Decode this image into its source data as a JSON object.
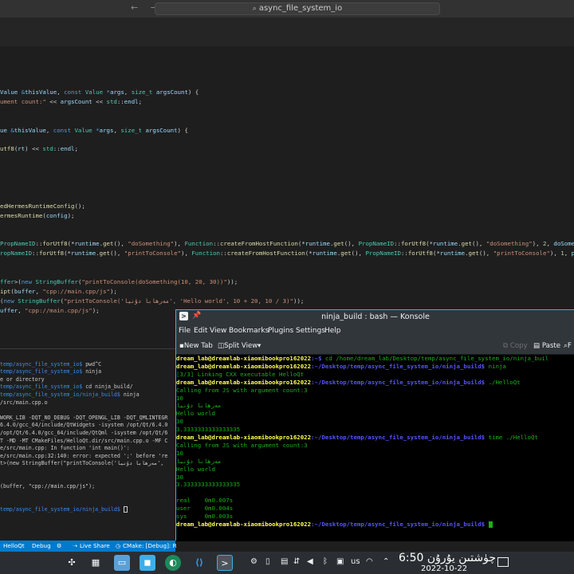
{
  "vscode": {
    "titlebar": {
      "nav_arrows": "← →",
      "search_text": "async_file_system_io"
    },
    "editor_lines": [
      {
        "segments": [
          [
            "var",
            "Value"
          ],
          [
            "plain",
            " "
          ],
          [
            "kw",
            "&"
          ],
          [
            "var",
            "thisValue"
          ],
          [
            "plain",
            ", "
          ],
          [
            "kw",
            "const"
          ],
          [
            "plain",
            " "
          ],
          [
            "ty",
            "Value"
          ],
          [
            "plain",
            " "
          ],
          [
            "kw",
            "*"
          ],
          [
            "var",
            "args"
          ],
          [
            "plain",
            ", "
          ],
          [
            "ty",
            "size_t"
          ],
          [
            "plain",
            " "
          ],
          [
            "var",
            "argsCount"
          ],
          [
            "plain",
            ") {"
          ]
        ]
      },
      {
        "segments": [
          [
            "str",
            "ument count:\""
          ],
          [
            "plain",
            " << "
          ],
          [
            "var",
            "argsCount"
          ],
          [
            "plain",
            " << "
          ],
          [
            "ty",
            "std"
          ],
          [
            "plain",
            "::"
          ],
          [
            "var",
            "endl"
          ],
          [
            "plain",
            ";"
          ]
        ]
      },
      {
        "segments": []
      },
      {
        "segments": []
      },
      {
        "segments": [
          [
            "var",
            "ue"
          ],
          [
            "plain",
            " "
          ],
          [
            "kw",
            "&"
          ],
          [
            "var",
            "thisValue"
          ],
          [
            "plain",
            ", "
          ],
          [
            "kw",
            "const"
          ],
          [
            "plain",
            " "
          ],
          [
            "ty",
            "Value"
          ],
          [
            "plain",
            " "
          ],
          [
            "kw",
            "*"
          ],
          [
            "var",
            "args"
          ],
          [
            "plain",
            ", "
          ],
          [
            "ty",
            "size_t"
          ],
          [
            "plain",
            " "
          ],
          [
            "var",
            "argsCount"
          ],
          [
            "plain",
            ") {"
          ]
        ]
      },
      {
        "segments": []
      },
      {
        "segments": [
          [
            "fn",
            "utf8"
          ],
          [
            "plain",
            "("
          ],
          [
            "var",
            "rt"
          ],
          [
            "plain",
            ") << "
          ],
          [
            "ty",
            "std"
          ],
          [
            "plain",
            "::"
          ],
          [
            "var",
            "endl"
          ],
          [
            "plain",
            ";"
          ]
        ]
      },
      {
        "segments": []
      },
      {
        "segments": []
      },
      {
        "segments": []
      },
      {
        "segments": []
      },
      {
        "segments": []
      },
      {
        "segments": [
          [
            "fn",
            "edHermesRuntimeConfig"
          ],
          [
            "plain",
            "();"
          ]
        ]
      },
      {
        "segments": [
          [
            "fn",
            "ermesRuntime"
          ],
          [
            "plain",
            "("
          ],
          [
            "var",
            "config"
          ],
          [
            "plain",
            ");"
          ]
        ]
      },
      {
        "segments": []
      },
      {
        "segments": []
      },
      {
        "segments": [
          [
            "ty",
            "PropNameID"
          ],
          [
            "plain",
            "::"
          ],
          [
            "fn",
            "forUtf8"
          ],
          [
            "plain",
            "(*"
          ],
          [
            "var",
            "runtime"
          ],
          [
            "plain",
            "."
          ],
          [
            "fn",
            "get"
          ],
          [
            "plain",
            "(), "
          ],
          [
            "str",
            "\"doSomething\""
          ],
          [
            "plain",
            "), "
          ],
          [
            "ty",
            "Function"
          ],
          [
            "plain",
            "::"
          ],
          [
            "fn",
            "createFromHostFunction"
          ],
          [
            "plain",
            "(*"
          ],
          [
            "var",
            "runtime"
          ],
          [
            "plain",
            "."
          ],
          [
            "fn",
            "get"
          ],
          [
            "plain",
            "(), "
          ],
          [
            "ty",
            "PropNameID"
          ],
          [
            "plain",
            "::"
          ],
          [
            "fn",
            "forUtf8"
          ],
          [
            "plain",
            "(*"
          ],
          [
            "var",
            "runtime"
          ],
          [
            "plain",
            "."
          ],
          [
            "fn",
            "get"
          ],
          [
            "plain",
            "(), "
          ],
          [
            "str",
            "\"doSomething\""
          ],
          [
            "plain",
            "), "
          ],
          [
            "num",
            "2"
          ],
          [
            "plain",
            ", "
          ],
          [
            "var",
            "doSomethingFromJs"
          ],
          [
            "plain",
            ")"
          ]
        ]
      },
      {
        "segments": [
          [
            "ty",
            "ropNameID"
          ],
          [
            "plain",
            "::"
          ],
          [
            "fn",
            "forUtf8"
          ],
          [
            "plain",
            "(*"
          ],
          [
            "var",
            "runtime"
          ],
          [
            "plain",
            "."
          ],
          [
            "fn",
            "get"
          ],
          [
            "plain",
            "(), "
          ],
          [
            "str",
            "\"printToConsole\""
          ],
          [
            "plain",
            "), "
          ],
          [
            "ty",
            "Function"
          ],
          [
            "plain",
            "::"
          ],
          [
            "fn",
            "createFromHostFunction"
          ],
          [
            "plain",
            "(*"
          ],
          [
            "var",
            "runtime"
          ],
          [
            "plain",
            "."
          ],
          [
            "fn",
            "get"
          ],
          [
            "plain",
            "(), "
          ],
          [
            "ty",
            "PropNameID"
          ],
          [
            "plain",
            "::"
          ],
          [
            "fn",
            "forUtf8"
          ],
          [
            "plain",
            "(*"
          ],
          [
            "var",
            "runtime"
          ],
          [
            "plain",
            "."
          ],
          [
            "fn",
            "get"
          ],
          [
            "plain",
            "(), "
          ],
          [
            "str",
            "\"printToConsole\""
          ],
          [
            "plain",
            "), "
          ],
          [
            "num",
            "1"
          ],
          [
            "plain",
            ", "
          ],
          [
            "var",
            "printToConsole"
          ]
        ]
      },
      {
        "segments": []
      },
      {
        "segments": []
      },
      {
        "segments": [
          [
            "ty",
            "ffer"
          ],
          [
            "plain",
            ">("
          ],
          [
            "kw",
            "new"
          ],
          [
            "plain",
            " "
          ],
          [
            "ty",
            "StringBuffer"
          ],
          [
            "plain",
            "("
          ],
          [
            "str",
            "\"printToConsole(doSomething(10, 20, 30))\""
          ],
          [
            "plain",
            "));"
          ]
        ]
      },
      {
        "segments": [
          [
            "fn",
            "ipt"
          ],
          [
            "plain",
            "("
          ],
          [
            "var",
            "buffer"
          ],
          [
            "plain",
            ", "
          ],
          [
            "str",
            "\"cpp://main.cpp/js\""
          ],
          [
            "plain",
            ");"
          ]
        ]
      },
      {
        "segments": [
          [
            "plain",
            "("
          ],
          [
            "kw",
            "new"
          ],
          [
            "plain",
            " "
          ],
          [
            "ty",
            "StringBuffer"
          ],
          [
            "plain",
            "("
          ],
          [
            "str",
            "\"printToConsole('مەرھابا دۇنيا', 'Hello world', 10 + 20, 10 / 3)\""
          ],
          [
            "plain",
            "));"
          ]
        ]
      },
      {
        "segments": [
          [
            "var",
            "uffer"
          ],
          [
            "plain",
            ", "
          ],
          [
            "str",
            "\"cpp://main.cpp/js\""
          ],
          [
            "plain",
            ");"
          ]
        ]
      }
    ],
    "terminal_lines": [
      {
        "prompt": "",
        "text": ""
      },
      {
        "prompt": "temp/async_file_system_io$",
        "text": " pwd^C"
      },
      {
        "prompt": "temp/async_file_system_io$",
        "text": " ninja"
      },
      {
        "prompt": "",
        "text": "e or directory"
      },
      {
        "prompt": "temp/async_file_system_io$",
        "text": " cd ninja_build/"
      },
      {
        "prompt": "temp/async_file_system_io/ninja_build$",
        "text": " ninja"
      },
      {
        "prompt": "",
        "text": "/src/main.cpp.o"
      },
      {
        "prompt": "",
        "text": ""
      },
      {
        "prompt": "",
        "text": "WORK_LIB -DQT_NO_DEBUG -DQT_OPENGL_LIB -DQT_QMLINTEGR"
      },
      {
        "prompt": "",
        "text": "6.4.0/gcc_64/include/QtWidgets -isystem /opt/Qt/6.4.0"
      },
      {
        "prompt": "",
        "text": "/opt/Qt/6.4.0/gcc_64/include/QtQml -isystem /opt/Qt/6"
      },
      {
        "prompt": "",
        "text": "T -MD -MT CMakeFiles/HelloQt.dir/src/main.cpp.o -MF C"
      },
      {
        "prompt": "",
        "text": "e/src/main.cpp: In function 'int main()':"
      },
      {
        "prompt": "",
        "text": "e/src/main.cpp:32:140: error: expected ';' before 're"
      },
      {
        "prompt": "",
        "text": "t>(new StringBuffer(\"printToConsole('مەرھابا دۇنيا',"
      },
      {
        "prompt": "",
        "text": ""
      },
      {
        "prompt": "",
        "text": ""
      },
      {
        "prompt": "",
        "text": "(buffer, \"cpp://main.cpp/js\");"
      },
      {
        "prompt": "",
        "text": ""
      },
      {
        "prompt": "",
        "text": ""
      },
      {
        "prompt": "temp/async_file_system_io/ninja_build$",
        "text": " "
      }
    ],
    "statusbar": {
      "target": "HelloQt",
      "build_type": "Debug",
      "live_share": "Live Share",
      "cmake": "CMake: [Debug]: R"
    }
  },
  "konsole": {
    "title": "ninja_build : bash — Konsole",
    "menus": [
      "File",
      "Edit",
      "View",
      "Bookmarks",
      "Plugins",
      "Settings",
      "Help"
    ],
    "toolbar": {
      "new_tab": "New Tab",
      "split_view": "Split View",
      "copy": "Copy",
      "paste": "Paste",
      "find": "F"
    },
    "lines": [
      {
        "user": "dream_lab@dreamlab-xiaomibookpro162022",
        "path": ":~$",
        "text": " cd /home/dream_lab/Desktop/temp/async_file_system_io/ninja_buil"
      },
      {
        "user": "dream_lab@dreamlab-xiaomibookpro162022",
        "path": ":~/Desktop/temp/async_file_system_io/ninja_build$",
        "text": " ninja"
      },
      {
        "user": "",
        "path": "",
        "text": "[3/3] Linking CXX executable HelloQt"
      },
      {
        "user": "dream_lab@dreamlab-xiaomibookpro162022",
        "path": ":~/Desktop/temp/async_file_system_io/ninja_build$",
        "text": " ./HelloQt"
      },
      {
        "user": "",
        "path": "",
        "text": "Calling from JS with argument count:3"
      },
      {
        "user": "",
        "path": "",
        "text": "10"
      },
      {
        "user": "",
        "path": "",
        "text": "مەرھابا دۇنيا"
      },
      {
        "user": "",
        "path": "",
        "text": "Hello world"
      },
      {
        "user": "",
        "path": "",
        "text": "30"
      },
      {
        "user": "",
        "path": "",
        "text": "3.3333333333333335"
      },
      {
        "user": "dream_lab@dreamlab-xiaomibookpro162022",
        "path": ":~/Desktop/temp/async_file_system_io/ninja_build$",
        "text": " time ./HelloQt"
      },
      {
        "user": "",
        "path": "",
        "text": "Calling from JS with argument count:3"
      },
      {
        "user": "",
        "path": "",
        "text": "10"
      },
      {
        "user": "",
        "path": "",
        "text": "مەرھابا دۇنيا"
      },
      {
        "user": "",
        "path": "",
        "text": "Hello world"
      },
      {
        "user": "",
        "path": "",
        "text": "30"
      },
      {
        "user": "",
        "path": "",
        "text": "3.3333333333333335"
      },
      {
        "user": "",
        "path": "",
        "text": ""
      },
      {
        "user": "",
        "path": "",
        "text": "real\t0m0.007s"
      },
      {
        "user": "",
        "path": "",
        "text": "user\t0m0.004s"
      },
      {
        "user": "",
        "path": "",
        "text": "sys\t0m0.003s"
      },
      {
        "user": "dream_lab@dreamlab-xiaomibookpro162022",
        "path": ":~/Desktop/temp/async_file_system_io/ninja_build$",
        "text": " "
      }
    ]
  },
  "taskbar": {
    "keyboard_layout": "us",
    "time": "6:50 چۈشتىن يۇرۇن",
    "date": "2022-10-22"
  }
}
